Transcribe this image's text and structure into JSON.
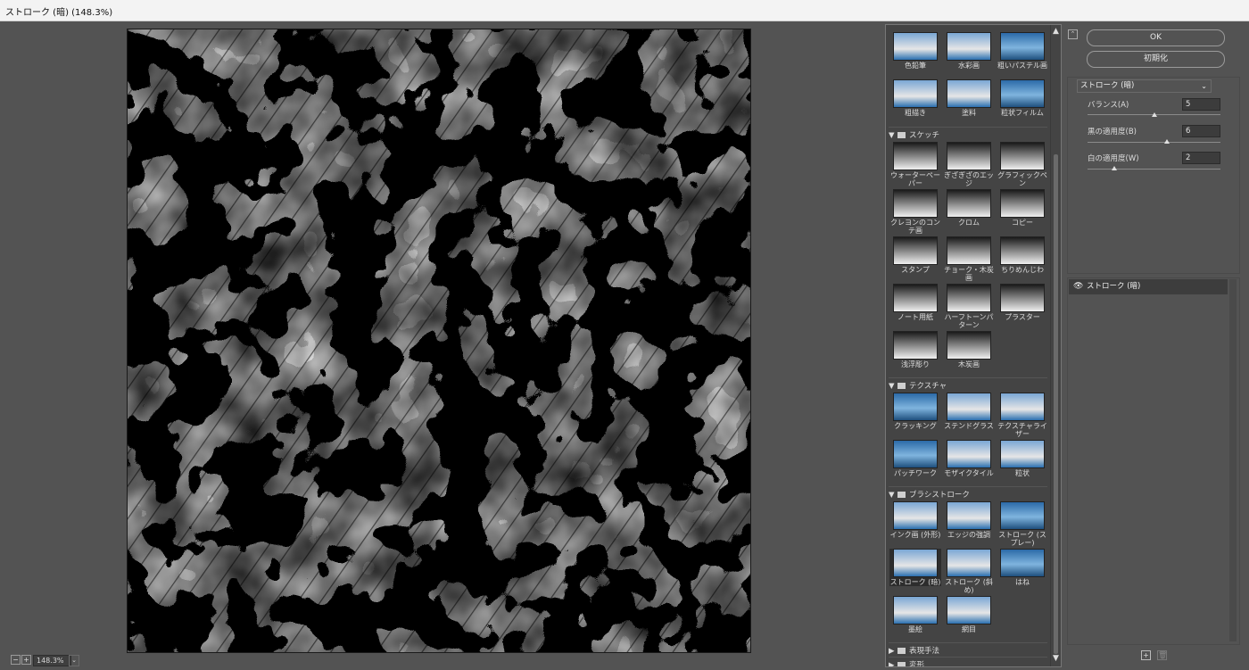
{
  "window": {
    "title": "ストローク (暗) (148.3%)"
  },
  "status": {
    "zoom_minus": "−",
    "zoom_plus": "+",
    "zoom": "148.3%",
    "zoom_dropdown": "⌄"
  },
  "buttons": {
    "ok": "OK",
    "reset": "初期化",
    "collapse": "⌃"
  },
  "filter": {
    "name": "ストローク (暗)",
    "chevron": "⌄"
  },
  "params": [
    {
      "label": "バランス(A)",
      "value": "5",
      "fraction": 0.5
    },
    {
      "label": "黒の適用度(B)",
      "value": "6",
      "fraction": 0.6
    },
    {
      "label": "白の適用度(W)",
      "value": "2",
      "fraction": 0.2
    }
  ],
  "layers": [
    {
      "name": "ストローク (暗)",
      "eye": "👁"
    }
  ],
  "gallery": {
    "scroll_up": "▲",
    "scroll_down": "▼",
    "top_items": [
      "色鉛筆",
      "水彩画",
      "粗いパステル画",
      "粗描き",
      "塗料",
      "粒状フィルム"
    ],
    "categories": [
      {
        "name": "スケッチ",
        "expanded": true,
        "items": [
          "ウォーターペーパー",
          "ぎざぎざのエッジ",
          "グラフィックペン",
          "クレヨンのコンテ画",
          "クロム",
          "コピー",
          "スタンプ",
          "チョーク・木炭画",
          "ちりめんじわ",
          "ノート用紙",
          "ハーフトーンパターン",
          "プラスター",
          "浅浮彫り",
          "木炭画"
        ]
      },
      {
        "name": "テクスチャ",
        "expanded": true,
        "items": [
          "クラッキング",
          "ステンドグラス",
          "テクスチャライザー",
          "パッチワーク",
          "モザイクタイル",
          "粒状"
        ]
      },
      {
        "name": "ブラシストローク",
        "expanded": true,
        "items": [
          "インク画 (外形)",
          "エッジの強調",
          "ストローク (スプレー)",
          "ストローク (暗)",
          "ストローク (斜め)",
          "はね",
          "墨絵",
          "網目"
        ]
      },
      {
        "name": "表現手法",
        "expanded": false,
        "items": []
      },
      {
        "name": "変形",
        "expanded": false,
        "items": []
      }
    ],
    "selected": "ストローク (暗)"
  },
  "colors": {
    "background": "#535353",
    "panel": "#444444",
    "titlebar": "#f3f3f3"
  },
  "icons": {
    "folder": "folder-icon",
    "new_layer": "new-layer-icon",
    "delete_layer": "trash-icon"
  },
  "bottom": {
    "new_layer": "+",
    "delete_layer": "🗑"
  }
}
